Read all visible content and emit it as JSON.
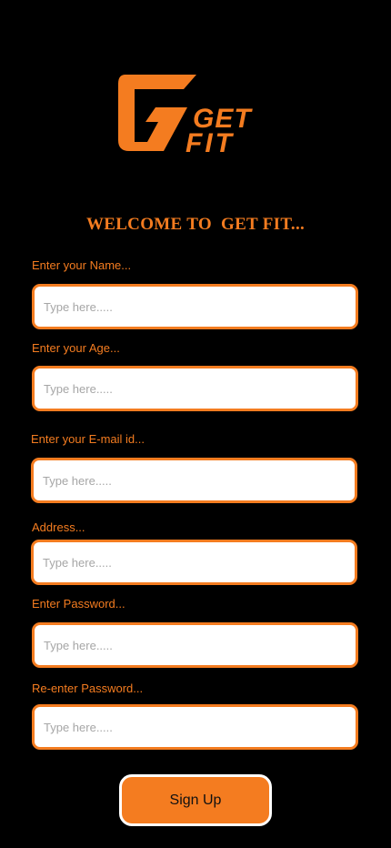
{
  "logo": {
    "text_line1": "GET",
    "text_line2": "FIT",
    "color": "#f47c20"
  },
  "welcome": {
    "title": "WELCOME TO  GET FIT..."
  },
  "form": {
    "fields": [
      {
        "label": "Enter your Name...",
        "placeholder": "Type here.....",
        "value": ""
      },
      {
        "label": "Enter your Age...",
        "placeholder": "Type here.....",
        "value": ""
      },
      {
        "label": "Enter your E-mail id...",
        "placeholder": "Type here.....",
        "value": ""
      },
      {
        "label": "Address...",
        "placeholder": "Type here.....",
        "value": ""
      },
      {
        "label": "Enter Password...",
        "placeholder": "Type here.....",
        "value": ""
      },
      {
        "label": "Re-enter Password...",
        "placeholder": "Type here.....",
        "value": ""
      }
    ],
    "submit_label": "Sign Up"
  },
  "colors": {
    "background": "#000000",
    "accent": "#f47c20",
    "input_background": "#ffffff",
    "button_border": "#ffffff"
  }
}
